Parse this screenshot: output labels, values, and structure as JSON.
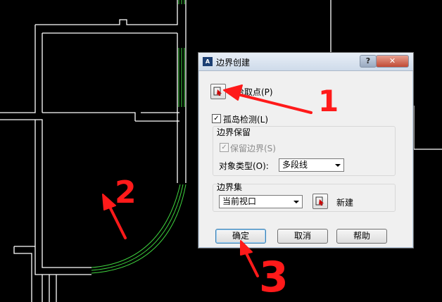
{
  "dialog": {
    "title": "边界创建",
    "help_label": "?",
    "close_label": "✕",
    "app_icon_text": "A"
  },
  "pick_point": {
    "label": "拾取点(P)"
  },
  "island_detection": {
    "label": "孤岛检测(L)",
    "checked": true
  },
  "boundary_retention": {
    "group_label": "边界保留",
    "retain_label": "保留边界(S)",
    "retain_checked": true,
    "object_type_label": "对象类型(O):",
    "object_type_value": "多段线"
  },
  "boundary_set": {
    "group_label": "边界集",
    "value": "当前视口",
    "new_label": "新建"
  },
  "buttons": {
    "ok": "确定",
    "cancel": "取消",
    "help": "帮助"
  },
  "annotations": [
    "1",
    "2",
    "3"
  ],
  "colors": {
    "annotation": "#ff1a1a",
    "arc": "#3fd23f",
    "lines": "#ffffff"
  }
}
